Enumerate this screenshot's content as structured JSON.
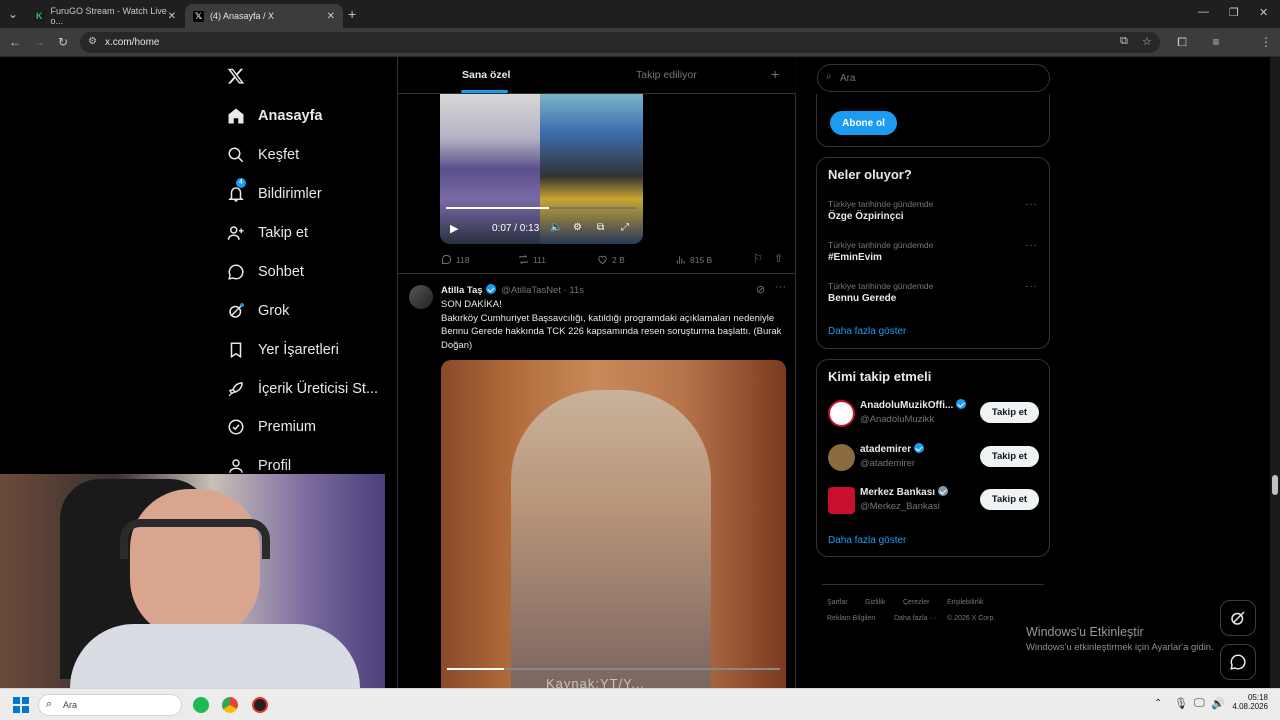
{
  "browser": {
    "tabs": [
      {
        "title": "FuruGO Stream - Watch Live o...",
        "favicon_color": "#22c55e"
      },
      {
        "title": "(4) Anasayfa / X",
        "favicon_color": "#000000"
      }
    ],
    "url": "x.com/home",
    "new_tab": "+"
  },
  "nav": {
    "items": [
      {
        "label": "Anasayfa",
        "icon": "home-icon"
      },
      {
        "label": "Keşfet",
        "icon": "search-icon"
      },
      {
        "label": "Bildirimler",
        "icon": "bell-icon",
        "badge": "4"
      },
      {
        "label": "Takip et",
        "icon": "person-add-icon"
      },
      {
        "label": "Sohbet",
        "icon": "chat-icon"
      },
      {
        "label": "Grok",
        "icon": "grok-icon"
      },
      {
        "label": "Yer İşaretleri",
        "icon": "bookmark-icon"
      },
      {
        "label": "İçerik Üreticisi St...",
        "icon": "rocket-icon"
      },
      {
        "label": "Premium",
        "icon": "verified-icon"
      },
      {
        "label": "Profil",
        "icon": "person-icon"
      }
    ]
  },
  "feed": {
    "tabs": [
      "Sana özel",
      "Takip ediliyor"
    ],
    "video1": {
      "time": "0:07 / 0:13"
    },
    "actions1": {
      "replies": "118",
      "reposts": "111",
      "likes": "2 B",
      "views": "815 B"
    },
    "tweet": {
      "name": "Atilla Taş",
      "handle": "@AtillaTasNet",
      "time": "· 11s",
      "line1": "SON DAKİKA!",
      "body": "Bakırköy Cumhuriyet Başsavcılığı, katıldığı programdaki açıklamaları nedeniyle Bennu Gerede hakkında TCK 226 kapsamında resen soruşturma başlattı. (Burak Doğan)",
      "video_caption": "Kaynak:YT/Y..."
    }
  },
  "sidebar": {
    "search_placeholder": "Ara",
    "subscribe_label": "Abone ol",
    "trends_title": "Neler oluyor?",
    "trends": [
      {
        "context": "Türkiye tarihinde gündemde",
        "name": "Özge Özpirinçci"
      },
      {
        "context": "Türkiye tarihinde gündemde",
        "name": "#EminEvim"
      },
      {
        "context": "Türkiye tarihinde gündemde",
        "name": "Bennu Gerede"
      }
    ],
    "show_more": "Daha fazla göster",
    "who_title": "Kimi takip etmeli",
    "who": [
      {
        "name": "AnadoluMuzikOffi...",
        "handle": "@AnadoluMuzikk",
        "verified": "blue"
      },
      {
        "name": "atademirer",
        "handle": "@atademirer",
        "verified": "blue"
      },
      {
        "name": "Merkez Bankası",
        "handle": "@Merkez_Bankasi",
        "verified": "gray"
      }
    ],
    "follow_label": "Takip et",
    "footer": [
      "Şartlar",
      "Gizlilik",
      "Çerezler",
      "Erişilebilirlik",
      "Reklam Bilgileri",
      "Daha fazla ···",
      "© 2026 X Corp."
    ]
  },
  "windows_activation": {
    "title": "Windows'u Etkinleştir",
    "subtitle": "Windows'u etkinleştirmek için Ayarlar'a gidin."
  },
  "taskbar": {
    "search_placeholder": "Ara",
    "time": "05:18",
    "date": "4.08.2026"
  }
}
